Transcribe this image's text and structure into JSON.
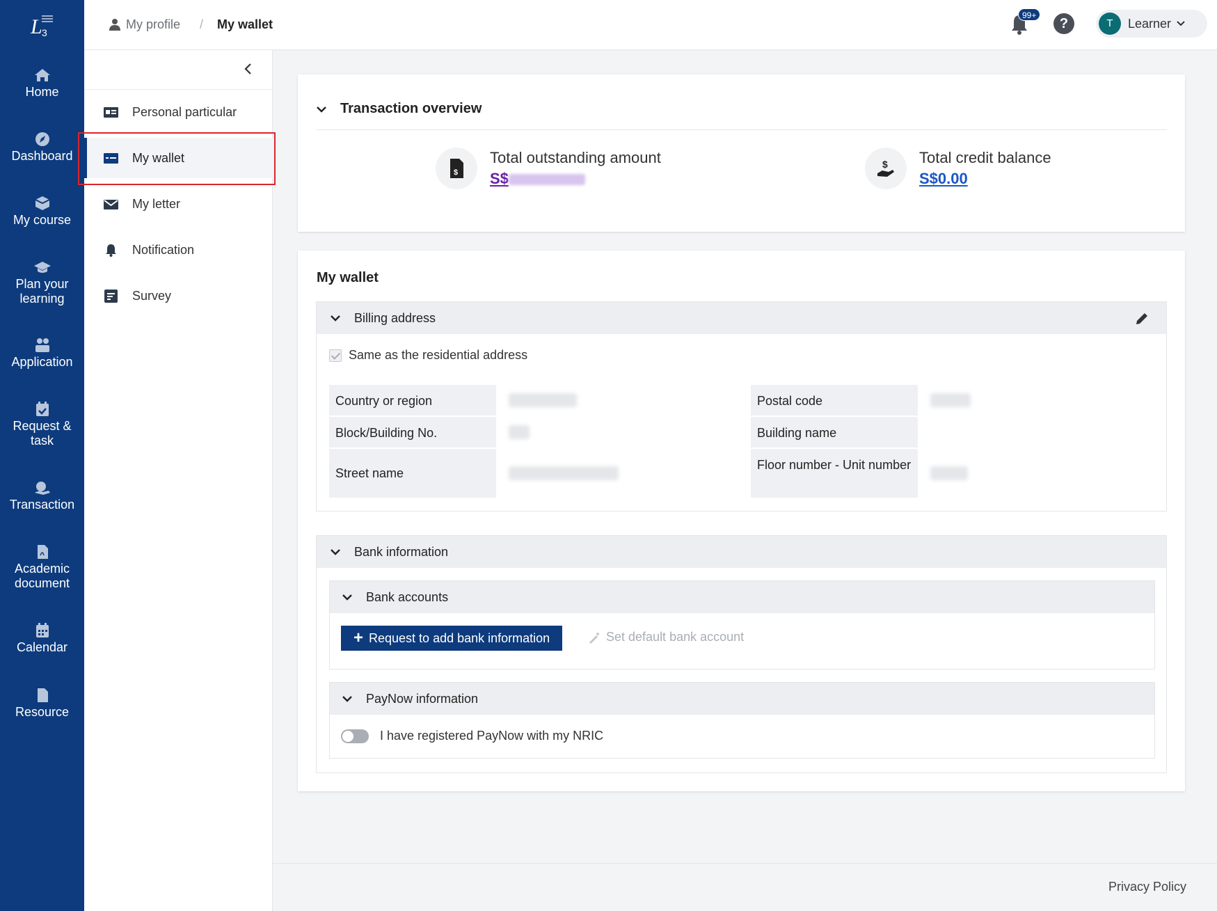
{
  "nav": {
    "items": [
      {
        "label": "Home",
        "icon": "home-icon"
      },
      {
        "label": "Dashboard",
        "icon": "compass-icon"
      },
      {
        "label": "My course",
        "icon": "box-icon"
      },
      {
        "label": "Plan your learning",
        "icon": "graduation-cap-icon"
      },
      {
        "label": "Application",
        "icon": "people-icon"
      },
      {
        "label": "Request & task",
        "icon": "calendar-check-icon"
      },
      {
        "label": "Transaction",
        "icon": "transaction-icon"
      },
      {
        "label": "Academic document",
        "icon": "pdf-icon"
      },
      {
        "label": "Calendar",
        "icon": "calendar-icon"
      },
      {
        "label": "Resource",
        "icon": "file-icon"
      }
    ]
  },
  "header": {
    "breadcrumb_parent": "My profile",
    "breadcrumb_sep": "/",
    "breadcrumb_current": "My wallet",
    "notification_badge": "99+",
    "help_glyph": "?",
    "user_initial": "T",
    "user_name": "Learner"
  },
  "subnav": {
    "items": [
      {
        "label": "Personal particular"
      },
      {
        "label": "My wallet"
      },
      {
        "label": "My letter"
      },
      {
        "label": "Notification"
      },
      {
        "label": "Survey"
      }
    ]
  },
  "overview": {
    "title": "Transaction overview",
    "outstanding_label": "Total outstanding amount",
    "outstanding_prefix": "S$",
    "credit_label": "Total credit balance",
    "credit_value": "S$0.00"
  },
  "wallet": {
    "title": "My wallet",
    "billing": {
      "title": "Billing address",
      "same_as_residential": "Same as the residential address",
      "fields": {
        "country": "Country or region",
        "postal": "Postal code",
        "block": "Block/Building No.",
        "building_name": "Building name",
        "street": "Street name",
        "floor_unit": "Floor number - Unit number"
      }
    },
    "bank": {
      "title": "Bank information",
      "accounts_title": "Bank accounts",
      "add_button": "Request to add bank information",
      "set_default": "Set default bank account",
      "paynow_title": "PayNow information",
      "paynow_toggle": "I have registered PayNow with my NRIC"
    }
  },
  "footer": {
    "privacy": "Privacy Policy"
  },
  "colors": {
    "nav_bg": "#0d3b7d",
    "primary": "#0d3b7d",
    "highlight": "#d9262c",
    "outstanding": "#6a1fa8",
    "credit": "#1a56c9"
  }
}
